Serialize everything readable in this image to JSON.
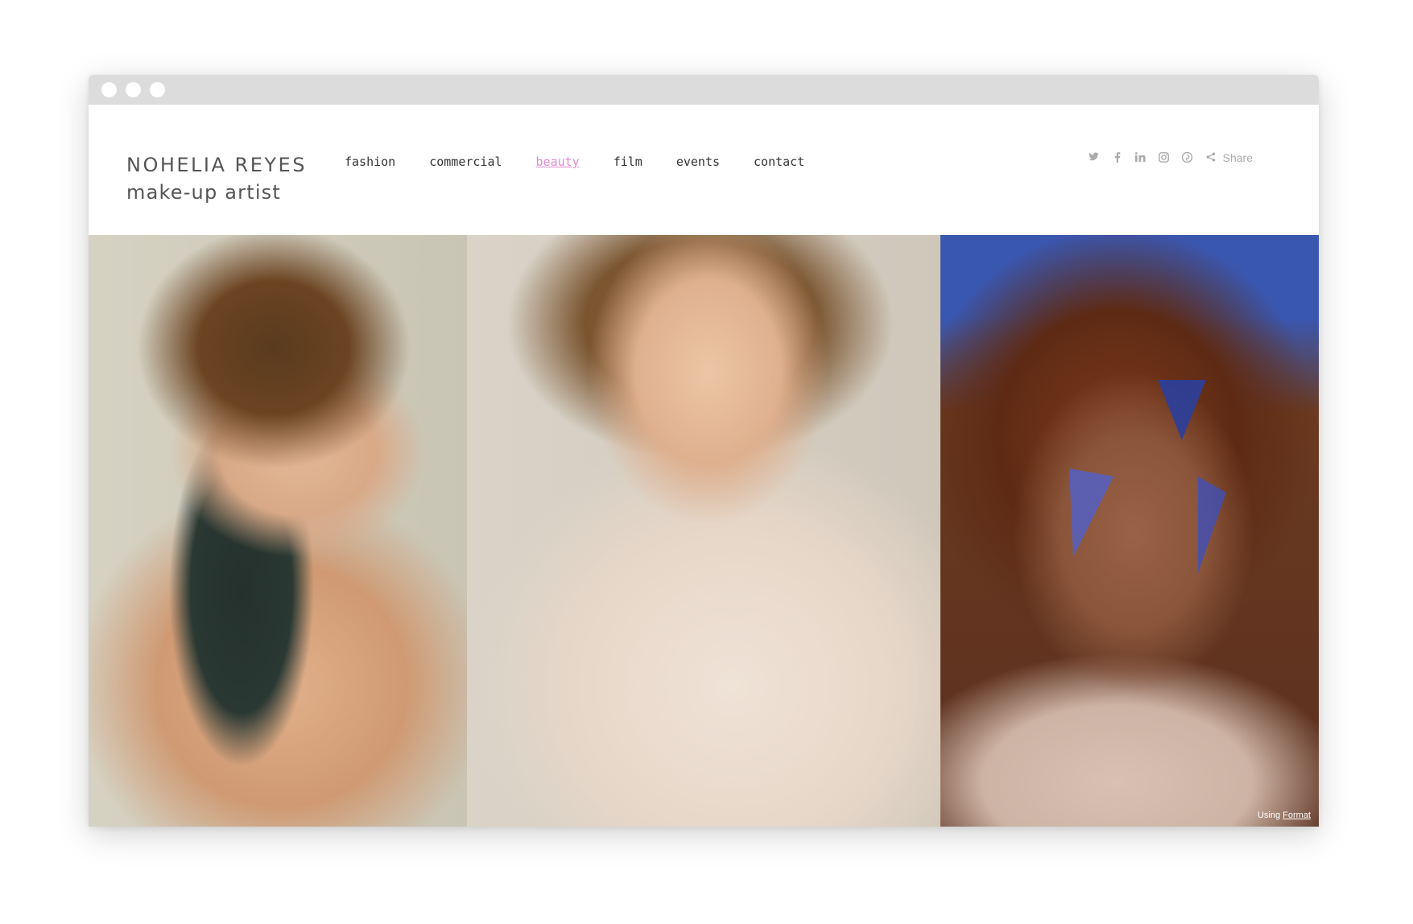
{
  "brand": {
    "name": "NOHELIA REYES",
    "role": "make-up artist"
  },
  "nav": {
    "items": [
      {
        "label": "fashion"
      },
      {
        "label": "commercial"
      },
      {
        "label": "beauty"
      },
      {
        "label": "film"
      },
      {
        "label": "events"
      },
      {
        "label": "contact"
      }
    ],
    "active": "beauty",
    "active_color": "#e08ad0"
  },
  "social": {
    "icons": [
      "twitter-icon",
      "facebook-icon",
      "linkedin-icon",
      "instagram-icon",
      "pinterest-icon",
      "share-icon"
    ],
    "share_label": "Share"
  },
  "gallery": {
    "photos": [
      {
        "name": "photo-woman-short-hair"
      },
      {
        "name": "photo-woman-knit-sweater"
      },
      {
        "name": "photo-woman-curly-hair-face-paint"
      }
    ]
  },
  "footer": {
    "using_label": "Using",
    "format_label": "Format"
  }
}
